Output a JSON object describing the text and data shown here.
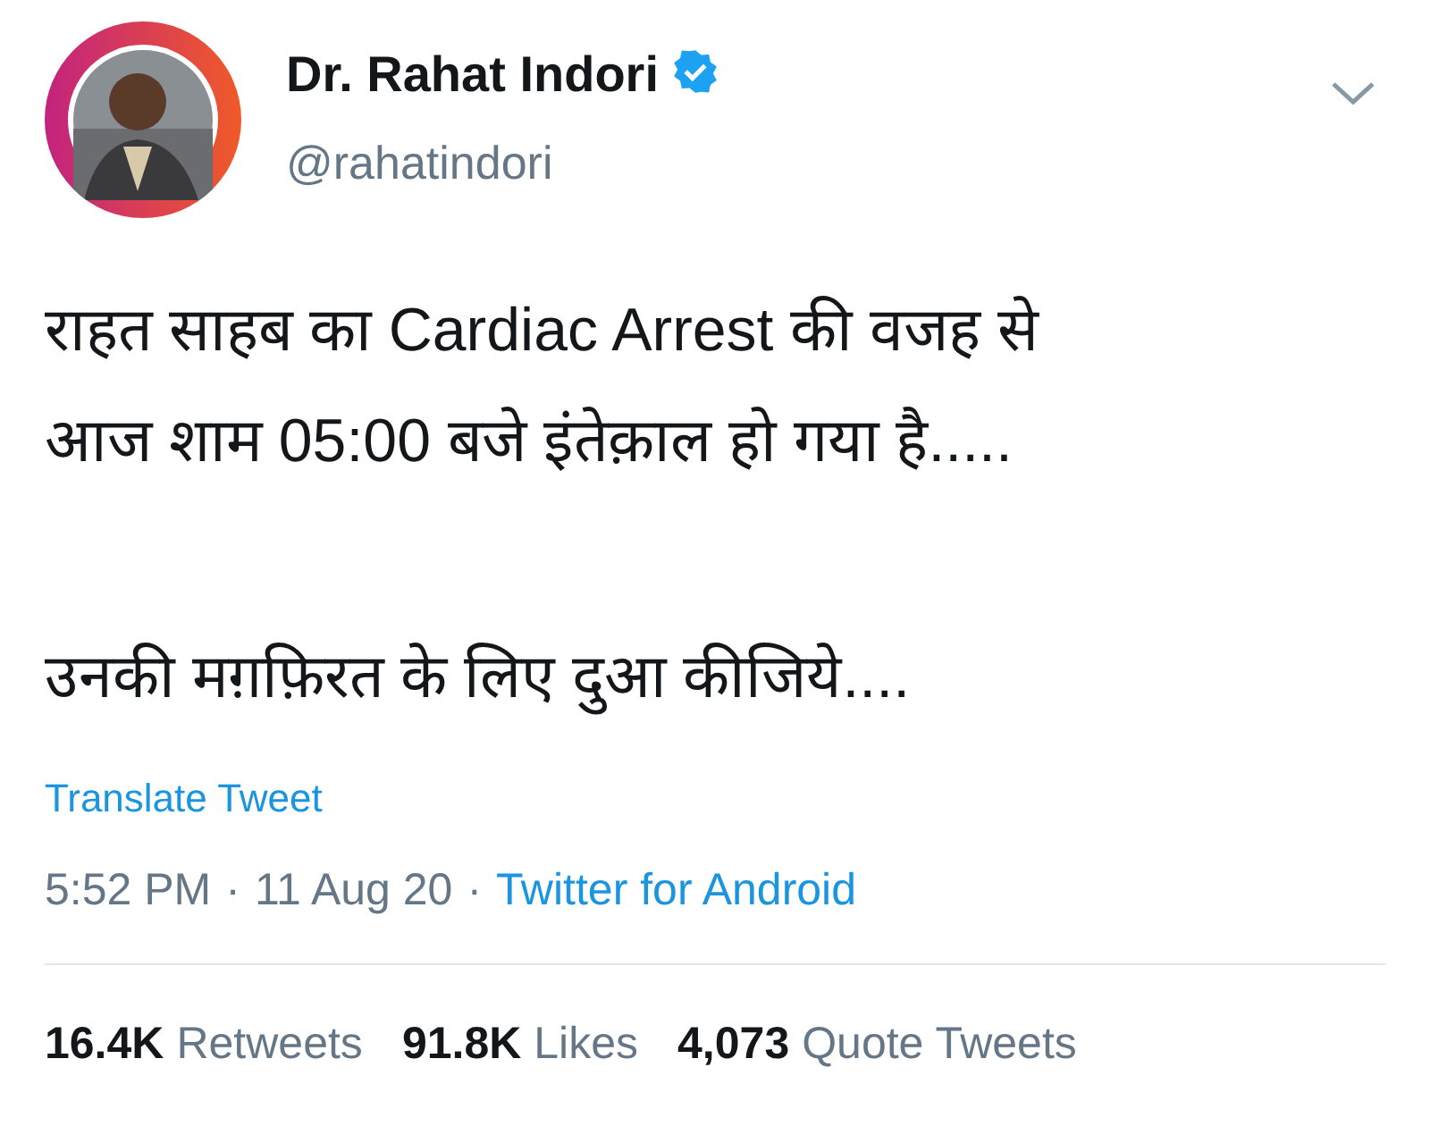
{
  "tweet": {
    "author": {
      "name": "Dr. Rahat Indori",
      "verified": true,
      "handle": "@rahatindori"
    },
    "paragraphs": [
      "राहत साहब का Cardiac Arrest की वजह से\nआज शाम 05:00 बजे इंतेक़ाल हो गया है.....",
      "उनकी मग़फ़िरत के लिए दुआ कीजिये...."
    ],
    "translate": "Translate Tweet",
    "meta": [
      {
        "kind": "text",
        "text": "5:52 PM"
      },
      {
        "kind": "separator",
        "text": "·"
      },
      {
        "kind": "text",
        "text": "11 Aug 20"
      },
      {
        "kind": "separator",
        "text": "·"
      },
      {
        "kind": "link",
        "text": "Twitter for Android"
      }
    ],
    "stats": [
      {
        "count": "16.4K",
        "label": "Retweets"
      },
      {
        "count": "91.8K",
        "label": "Likes"
      },
      {
        "count": "4,073",
        "label": "Quote Tweets"
      }
    ]
  }
}
